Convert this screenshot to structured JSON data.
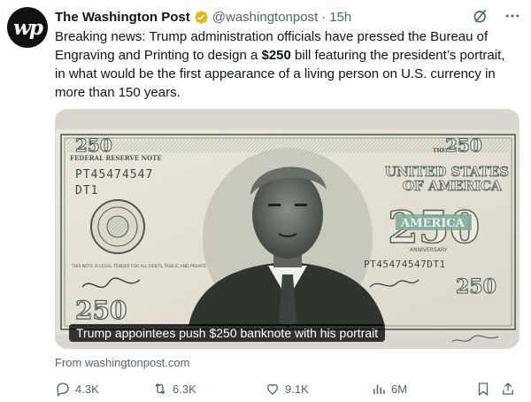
{
  "account": {
    "avatar_text": "wp",
    "name": "The Washington Post",
    "handle": "@washingtonpost",
    "separator": "·",
    "time": "15h",
    "verified_color": "#e2b719"
  },
  "tweet": {
    "text_before": "Breaking news: Trump administration officials have pressed the Bureau of Engraving and Printing to design a ",
    "text_bold": "$250",
    "text_after": " bill featuring the president’s portrait, in what would be the first appearance of a living person on U.S. currency in more than 150 years."
  },
  "media": {
    "caption": "Trump appointees push $250 banknote with his portrait",
    "banknote": {
      "corner_value": "250",
      "header": "FEDERAL RESERVE NOTE",
      "serial": "PT45474547",
      "serial_suffix": "DT1",
      "serial_full": "PT45474547DT1",
      "country_line1": "THE",
      "country_line2": "UNITED STATES",
      "country_line3": "OF AMERICA",
      "america": "AMERICA",
      "anniversary": "ANNIVERSARY",
      "big_value": "250",
      "legal_tender": "THIS NOTE IS LEGAL TENDER FOR ALL DEBTS, PUBLIC AND PRIVATE",
      "seal_text": "UNITED STATES FEDERAL RESERVE SYSTEM"
    }
  },
  "source": "From washingtonpost.com",
  "actions": {
    "replies": "4.3K",
    "reposts": "6.3K",
    "likes": "9.1K",
    "views": "6M"
  },
  "colors": {
    "text": "#0f1419",
    "muted": "#536471",
    "note_paper": "#e6e3d6",
    "note_ink": "#4e5a50"
  }
}
